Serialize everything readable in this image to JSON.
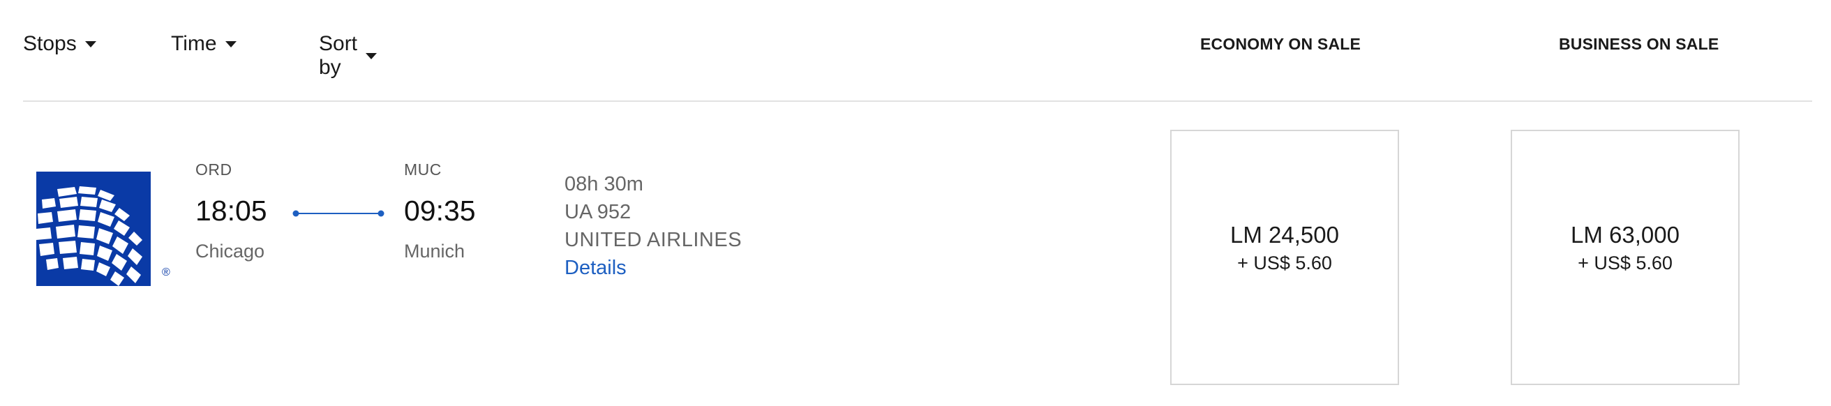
{
  "filters": {
    "stops_label": "Stops",
    "time_label": "Time",
    "sort_label": "Sort by"
  },
  "columns": {
    "economy": "ECONOMY ON SALE",
    "business": "BUSINESS ON SALE"
  },
  "flight": {
    "airline_logo": "united-airlines-globe-icon",
    "origin": {
      "code": "ORD",
      "time": "18:05",
      "city": "Chicago"
    },
    "destination": {
      "code": "MUC",
      "time": "09:35",
      "city": "Munich"
    },
    "duration": "08h 30m",
    "flight_number": "UA 952",
    "airline": "UNITED AIRLINES",
    "details_link": "Details",
    "fares": {
      "economy": {
        "miles": "LM 24,500",
        "tax": "+ US$ 5.60"
      },
      "business": {
        "miles": "LM 63,000",
        "tax": "+ US$ 5.60"
      }
    }
  },
  "colors": {
    "brand_blue": "#0a3aa6",
    "link_blue": "#1d5fc1",
    "route_line": "#1d5fc1"
  }
}
